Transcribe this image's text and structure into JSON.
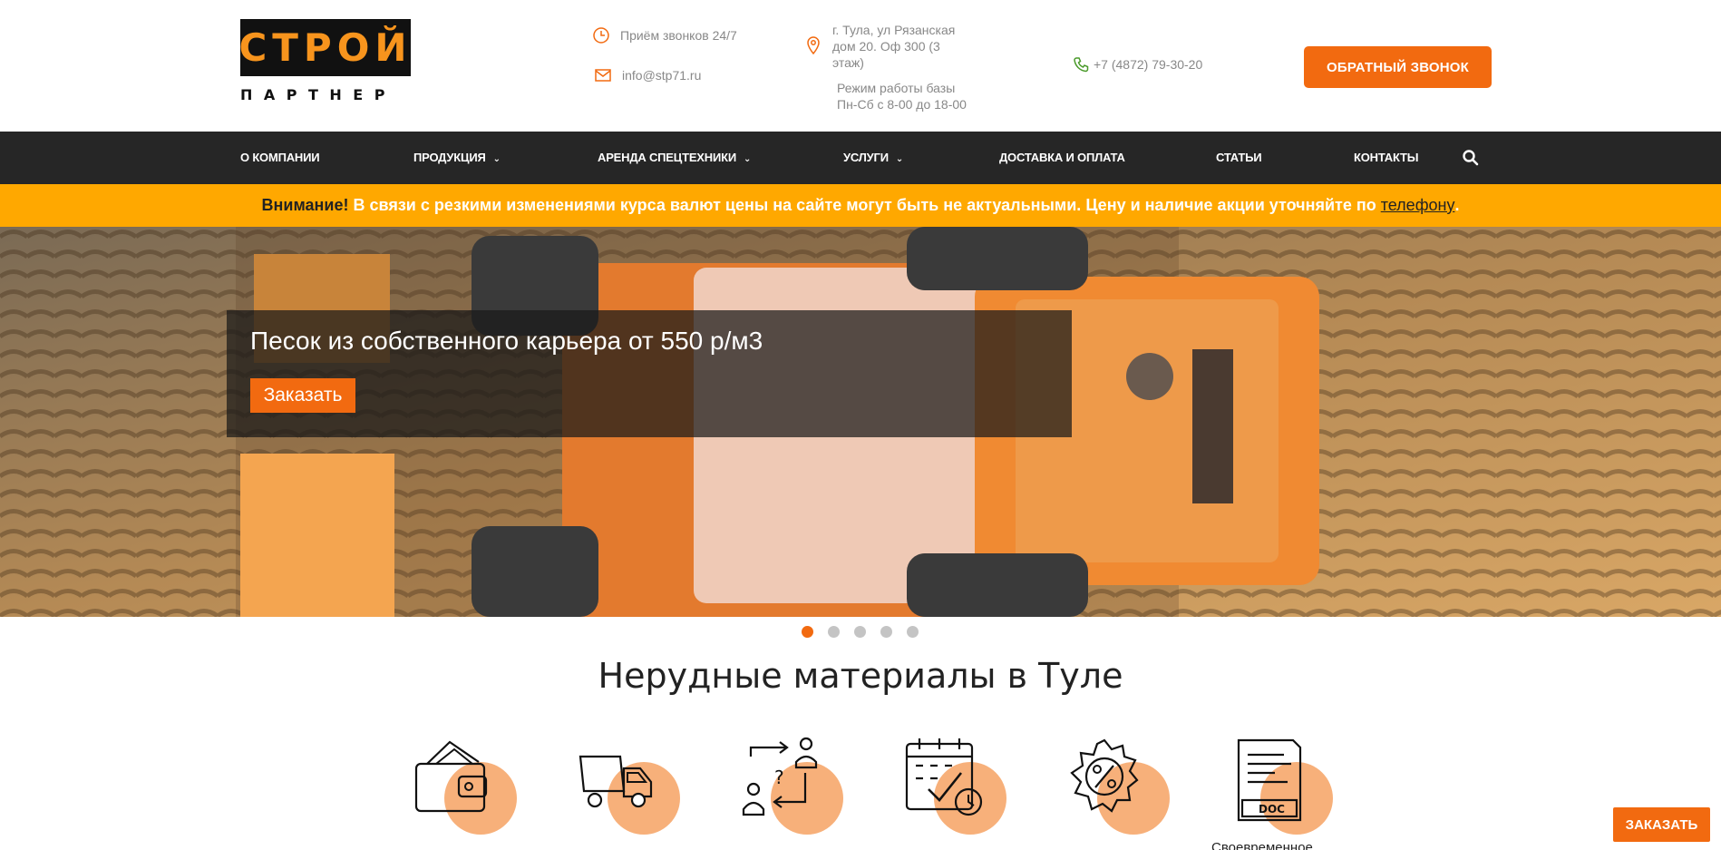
{
  "logo": {
    "top": "СТРОЙ",
    "bottom": "ПАРТНЕР"
  },
  "header": {
    "calls": "Приём звонков 24/7",
    "email": "info@stp71.ru",
    "address": "г. Тула, ул Рязанская дом 20. Оф 300 (3 этаж)",
    "hours_line1": "Режим работы базы",
    "hours_line2": "Пн-Сб с 8-00 до 18-00",
    "phone": "+7 (4872) 79-30-20",
    "callback_label": "ОБРАТНЫЙ ЗВОНОК"
  },
  "nav": {
    "items": [
      {
        "label": "О КОМПАНИИ"
      },
      {
        "label": "ПРОДУКЦИЯ"
      },
      {
        "label": "АРЕНДА СПЕЦТЕХНИКИ"
      },
      {
        "label": "УСЛУГИ"
      },
      {
        "label": "ДОСТАВКА И ОПЛАТА"
      },
      {
        "label": "СТАТЬИ"
      },
      {
        "label": "КОНТАКТЫ"
      }
    ],
    "search_icon": "search-icon"
  },
  "notice": {
    "bold": "Внимание!",
    "text": " В связи с резкими изменениями курса валют цены на сайте могут быть не актуальными. Цену и наличие акции уточняйте по ",
    "link": "телефону",
    "end": "."
  },
  "hero": {
    "title": "Песок из собственного карьера от 550 р/м3",
    "button_label": "Заказать"
  },
  "slider": {
    "count": 5,
    "active": 1
  },
  "section": {
    "title": "Нерудные материалы в Туле",
    "features": [
      {
        "icon": "wallet-icon"
      },
      {
        "icon": "dump-truck-icon"
      },
      {
        "icon": "exchange-icon"
      },
      {
        "icon": "calendar-icon"
      },
      {
        "icon": "gear-percent-icon"
      },
      {
        "icon": "document-icon"
      }
    ],
    "partial_label": "Своевременное"
  },
  "float_order_label": "ЗАКАЗАТЬ",
  "colors": {
    "accent": "#f26a10",
    "notice": "#ffa800",
    "nav": "#262626",
    "logo_orange": "#f7941d"
  }
}
